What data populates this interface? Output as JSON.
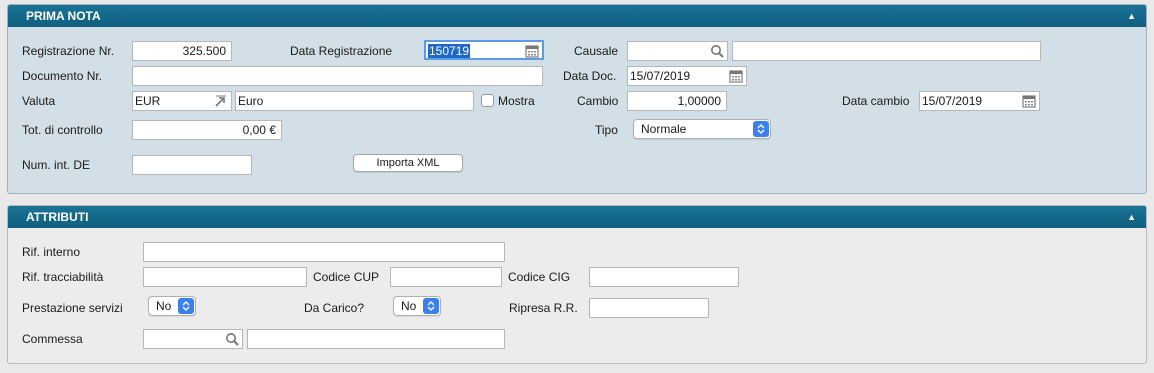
{
  "prima_nota": {
    "title": "PRIMA NOTA",
    "registrazione_nr": {
      "label": "Registrazione Nr.",
      "value": "325.500"
    },
    "data_registrazione": {
      "label": "Data Registrazione",
      "value": "150719"
    },
    "causale": {
      "label": "Causale",
      "code": "",
      "description": ""
    },
    "documento_nr": {
      "label": "Documento Nr.",
      "value": ""
    },
    "data_doc": {
      "label": "Data Doc.",
      "value": "15/07/2019"
    },
    "valuta": {
      "label": "Valuta",
      "code": "EUR",
      "description": "Euro"
    },
    "mostra": {
      "label": "Mostra",
      "checked": false
    },
    "cambio": {
      "label": "Cambio",
      "value": "1,00000"
    },
    "data_cambio": {
      "label": "Data cambio",
      "value": "15/07/2019"
    },
    "tot_controllo": {
      "label": "Tot. di controllo",
      "value": "0,00 €"
    },
    "tipo": {
      "label": "Tipo",
      "value": "Normale"
    },
    "num_int_de": {
      "label": "Num. int. DE",
      "value": ""
    },
    "importa_xml": {
      "label": "Importa XML"
    }
  },
  "attributi": {
    "title": "ATTRIBUTI",
    "rif_interno": {
      "label": "Rif. interno",
      "value": ""
    },
    "rif_tracciabilita": {
      "label": "Rif. tracciabilità",
      "value": ""
    },
    "codice_cup": {
      "label": "Codice CUP",
      "value": ""
    },
    "codice_cig": {
      "label": "Codice CIG",
      "value": ""
    },
    "prestazione_servizi": {
      "label": "Prestazione servizi",
      "value": "No"
    },
    "da_carico": {
      "label": "Da Carico?",
      "value": "No"
    },
    "ripresa_rr": {
      "label": "Ripresa R.R.",
      "value": ""
    },
    "commessa": {
      "label": "Commessa",
      "code": "",
      "description": ""
    }
  },
  "icons": {
    "collapse": "chevron-up-icon",
    "calendar": "calendar-icon",
    "search": "search-icon",
    "lookup": "lookup-arrow-icon",
    "stepper": "up-down-arrows-icon"
  },
  "colors": {
    "header_bg": "#0f5f80",
    "panel_bg": "#d3dfe6",
    "selection": "#1e68c9",
    "select_accent": "#3a80f0"
  }
}
